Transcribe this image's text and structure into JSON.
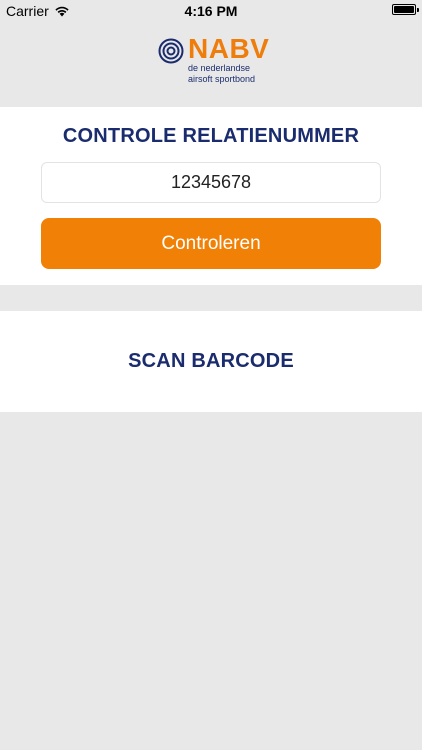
{
  "status_bar": {
    "carrier": "Carrier",
    "time": "4:16 PM"
  },
  "logo": {
    "name": "NABV",
    "tagline_line1": "de nederlandse",
    "tagline_line2": "airsoft sportbond",
    "brand_color": "#ee7d0c",
    "secondary_color": "#1b2c6e"
  },
  "check_section": {
    "title": "CONTROLE RELATIENUMMER",
    "input_value": "12345678",
    "button_label": "Controleren",
    "button_color": "#f08106"
  },
  "scan_section": {
    "label": "SCAN BARCODE"
  }
}
